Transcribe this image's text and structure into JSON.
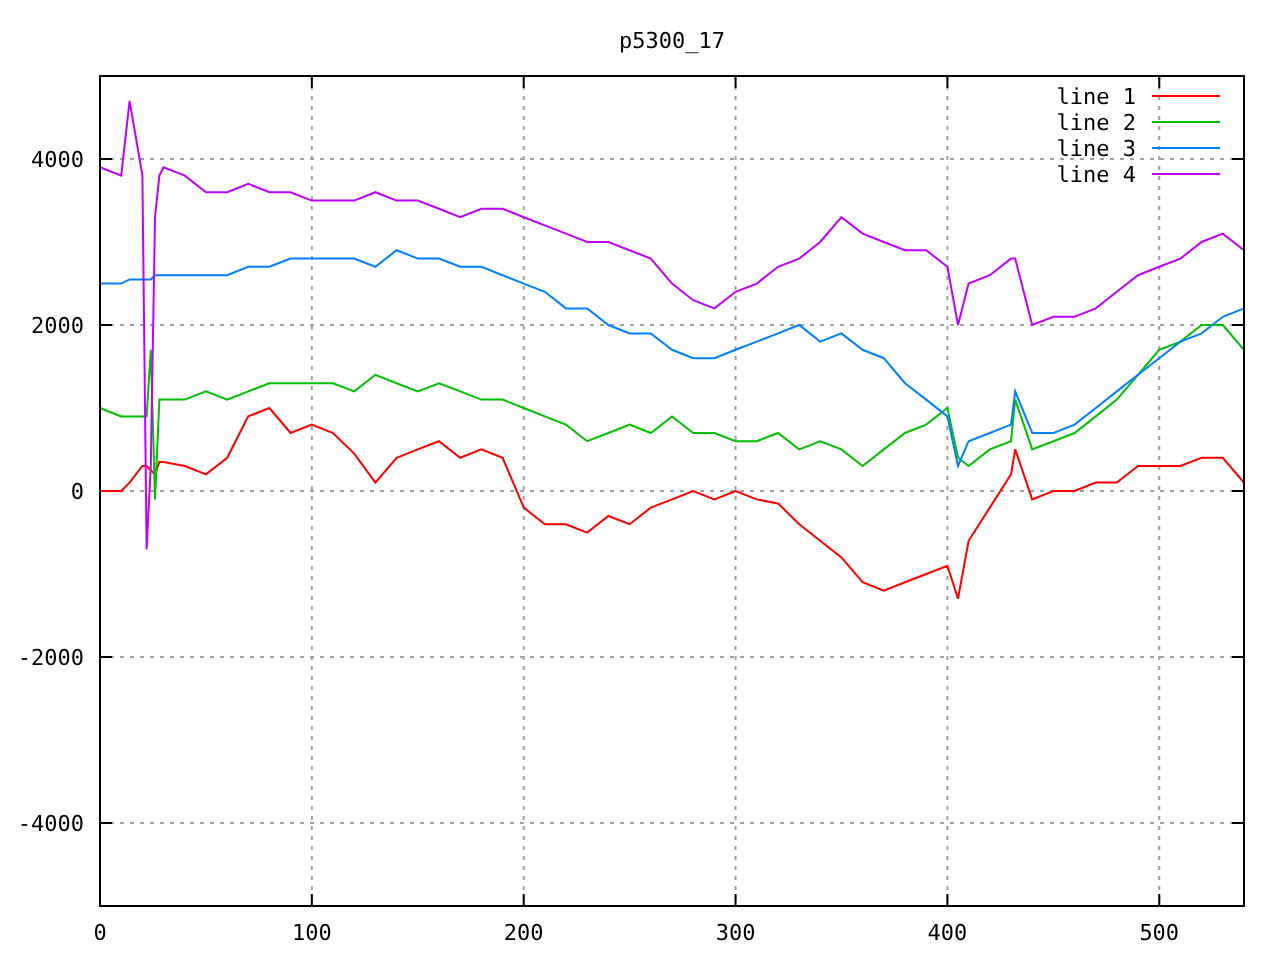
{
  "chart_data": {
    "type": "line",
    "title": "p5300_17",
    "x": [
      0,
      10,
      14,
      20,
      22,
      24,
      26,
      28,
      30,
      40,
      50,
      60,
      70,
      80,
      90,
      100,
      110,
      120,
      130,
      140,
      150,
      160,
      170,
      180,
      190,
      200,
      210,
      220,
      230,
      240,
      250,
      260,
      270,
      280,
      290,
      300,
      310,
      320,
      330,
      340,
      350,
      360,
      370,
      380,
      390,
      400,
      405,
      410,
      420,
      430,
      432,
      440,
      450,
      460,
      470,
      480,
      490,
      500,
      510,
      520,
      530,
      540
    ],
    "series": [
      {
        "name": "line 1",
        "color": "#ff0000",
        "values": [
          0,
          0,
          100,
          300,
          300,
          250,
          200,
          350,
          350,
          300,
          200,
          400,
          900,
          1000,
          700,
          800,
          700,
          450,
          100,
          400,
          500,
          600,
          400,
          500,
          400,
          -200,
          -400,
          -400,
          -500,
          -300,
          -400,
          -200,
          -100,
          0,
          -100,
          0,
          -100,
          -150,
          -400,
          -600,
          -800,
          -1100,
          -1200,
          -1100,
          -1000,
          -900,
          -1300,
          -600,
          -200,
          200,
          500,
          -100,
          0,
          0,
          100,
          100,
          300,
          300,
          300,
          400,
          400,
          100
        ]
      },
      {
        "name": "line 2",
        "color": "#00c000",
        "values": [
          1000,
          900,
          900,
          900,
          900,
          1700,
          -100,
          1100,
          1100,
          1100,
          1200,
          1100,
          1200,
          1300,
          1300,
          1300,
          1300,
          1200,
          1400,
          1300,
          1200,
          1300,
          1200,
          1100,
          1100,
          1000,
          900,
          800,
          600,
          700,
          800,
          700,
          900,
          700,
          700,
          600,
          600,
          700,
          500,
          600,
          500,
          300,
          500,
          700,
          800,
          1000,
          400,
          300,
          500,
          600,
          1100,
          500,
          600,
          700,
          900,
          1100,
          1400,
          1700,
          1800,
          2000,
          2000,
          1700
        ]
      },
      {
        "name": "line 3",
        "color": "#0080ff",
        "values": [
          2500,
          2500,
          2550,
          2550,
          2550,
          2550,
          2600,
          2600,
          2600,
          2600,
          2600,
          2600,
          2700,
          2700,
          2800,
          2800,
          2800,
          2800,
          2700,
          2900,
          2800,
          2800,
          2700,
          2700,
          2600,
          2500,
          2400,
          2200,
          2200,
          2000,
          1900,
          1900,
          1700,
          1600,
          1600,
          1700,
          1800,
          1900,
          2000,
          1800,
          1900,
          1700,
          1600,
          1300,
          1100,
          900,
          300,
          600,
          700,
          800,
          1200,
          700,
          700,
          800,
          1000,
          1200,
          1400,
          1600,
          1800,
          1900,
          2100,
          2200
        ]
      },
      {
        "name": "line 4",
        "color": "#c000ff",
        "values": [
          3900,
          3800,
          4700,
          3800,
          -700,
          300,
          3300,
          3800,
          3900,
          3800,
          3600,
          3600,
          3700,
          3600,
          3600,
          3500,
          3500,
          3500,
          3600,
          3500,
          3500,
          3400,
          3300,
          3400,
          3400,
          3300,
          3200,
          3100,
          3000,
          3000,
          2900,
          2800,
          2500,
          2300,
          2200,
          2400,
          2500,
          2700,
          2800,
          3000,
          3300,
          3100,
          3000,
          2900,
          2900,
          2700,
          2000,
          2500,
          2600,
          2800,
          2800,
          2000,
          2100,
          2100,
          2200,
          2400,
          2600,
          2700,
          2800,
          3000,
          3100,
          2900
        ]
      }
    ],
    "xlim": [
      0,
      540
    ],
    "ylim": [
      -5000,
      5000
    ],
    "xticks": [
      0,
      100,
      200,
      300,
      400,
      500
    ],
    "yticks": [
      -4000,
      -2000,
      0,
      2000,
      4000
    ],
    "grid": true,
    "legend": true
  }
}
